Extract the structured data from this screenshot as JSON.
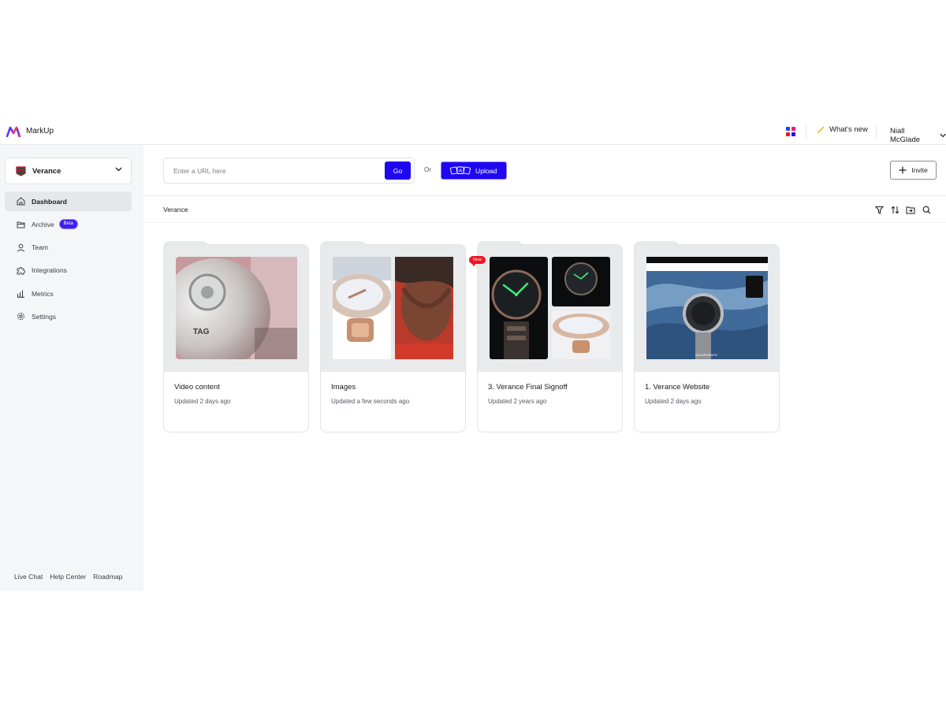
{
  "app": {
    "brand": "MarkUp",
    "whats_new_label": "What's new",
    "user_name": "Niall McGlade"
  },
  "colors": {
    "accent": "#1f08ef",
    "badge_new": "#ef1424",
    "sidebar_bg": "#f5f6f8",
    "logo_purple": "#6b2ff0",
    "logo_red": "#ef3b5a"
  },
  "workspace": {
    "name": "Verance"
  },
  "sidebar": {
    "items": [
      {
        "label": "Dashboard",
        "icon": "home-icon",
        "active": true
      },
      {
        "label": "Archive",
        "icon": "folder-icon",
        "badge": "Beta"
      },
      {
        "label": "Team",
        "icon": "user-icon"
      },
      {
        "label": "Integrations",
        "icon": "puzzle-icon"
      },
      {
        "label": "Metrics",
        "icon": "bar-chart-icon"
      },
      {
        "label": "Settings",
        "icon": "gear-icon"
      }
    ],
    "footer": [
      "Live Chat",
      "Help Center",
      "Roadmap"
    ]
  },
  "toolbar": {
    "url_placeholder": "Enter a URL here",
    "go_label": "Go",
    "or_label": "Or",
    "upload_label": "Upload",
    "invite_label": "Invite"
  },
  "breadcrumb": "Verance",
  "tools": [
    "filter-icon",
    "sort-icon",
    "folder-move-icon",
    "search-icon"
  ],
  "folders": [
    {
      "title": "Video content",
      "updated": "Updated 2 days ago"
    },
    {
      "title": "Images",
      "updated": "Updated a few seconds ago"
    },
    {
      "title": "3. Verance Final Signoff",
      "updated": "Updated 2 years ago",
      "badge": "New"
    },
    {
      "title": "1. Verance Website",
      "updated": "Updated 2 days ago"
    }
  ]
}
